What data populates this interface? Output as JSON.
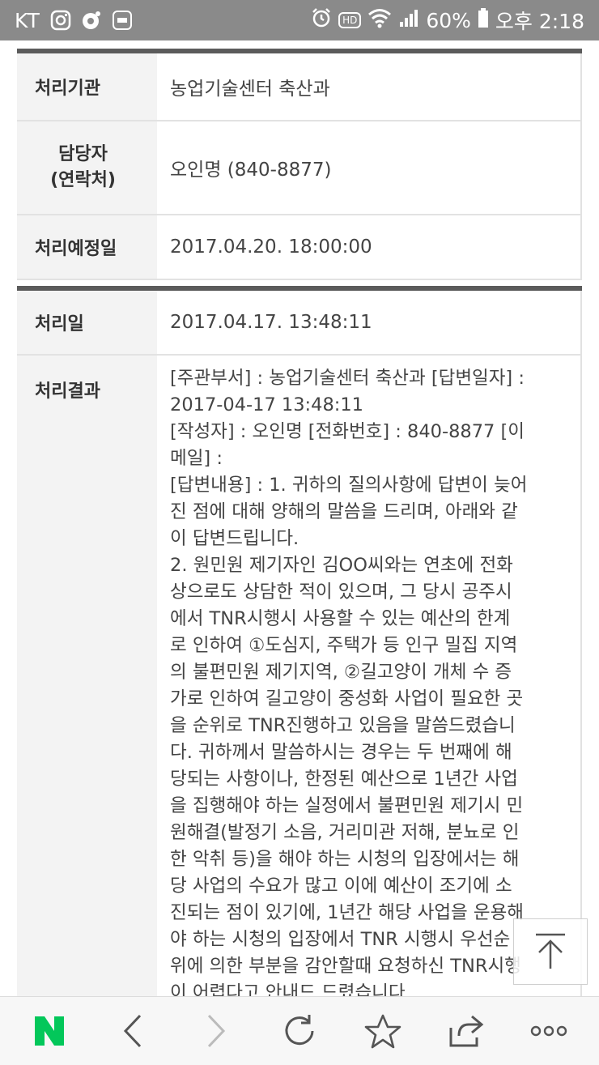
{
  "status_bar": {
    "carrier": "KT",
    "icons": [
      "instagram-icon",
      "record-icon",
      "app-icon",
      "alarm-icon",
      "hd-voice-icon",
      "wifi-icon",
      "signal-icon",
      "battery-icon"
    ],
    "hd_label": "HD",
    "battery": "60%",
    "time": "오후 2:18"
  },
  "table1": {
    "rows": [
      {
        "label": "처리기관",
        "value": "농업기술센터 축산과"
      },
      {
        "label": "담당자\n(연락처)",
        "value": "오인명 (840-8877)"
      },
      {
        "label": "처리예정일",
        "value": "2017.04.20. 18:00:00"
      }
    ]
  },
  "table2": {
    "processed_label": "처리일",
    "processed_value": "2017.04.17. 13:48:11",
    "result_label": "처리결과",
    "result_text": "[주관부서] : 농업기술센터 축산과 [답변일자] :\n2017-04-17 13:48:11\n[작성자] : 오인명 [전화번호] : 840-8877 [이\n메일] :\n[답변내용] : 1. 귀하의 질의사항에 답변이 늦어\n진 점에 대해 양해의 말씀을 드리며, 아래와 같\n이 답변드립니다.\n2. 원민원 제기자인 김OO씨와는 연초에 전화\n상으로도 상담한 적이 있으며, 그 당시 공주시\n에서 TNR시행시 사용할 수 있는 예산의 한계\n로 인하여 ①도심지, 주택가 등 인구 밀집 지역\n의 불편민원 제기지역, ②길고양이 개체 수 증\n가로 인하여 길고양이 중성화 사업이 필요한 곳\n을 순위로 TNR진행하고 있음을 말씀드렸습니\n다. 귀하께서 말씀하시는 경우는 두 번째에 해\n당되는 사항이나, 한정된 예산으로 1년간 사업\n을 집행해야 하는 실정에서 불편민원 제기시 민\n원해결(발정기 소음, 거리미관 저해, 분뇨로 인\n한 악취 등)을 해야 하는 시청의 입장에서는 해\n당 사업의 수요가 많고 이에 예산이 조기에 소\n진되는 점이 있기에, 1년간 해당 사업을 운용해\n야 하는 시청의 입장에서 TNR 시행시 우선순\n위에 의한 부분을 감안할때 요청하신 TNR시행\n이 어렵다고 안내드 드렸습니다"
  },
  "bottom_bar": {
    "buttons": [
      "naver-logo-icon",
      "back-icon",
      "forward-icon",
      "reload-icon",
      "bookmark-star-icon",
      "share-icon",
      "more-icon"
    ]
  },
  "colors": {
    "status_bar": "#8a8a8a",
    "table_top_border": "#5b5b5b",
    "label_bg": "#f3f3f3",
    "naver_green": "#03c75a"
  }
}
